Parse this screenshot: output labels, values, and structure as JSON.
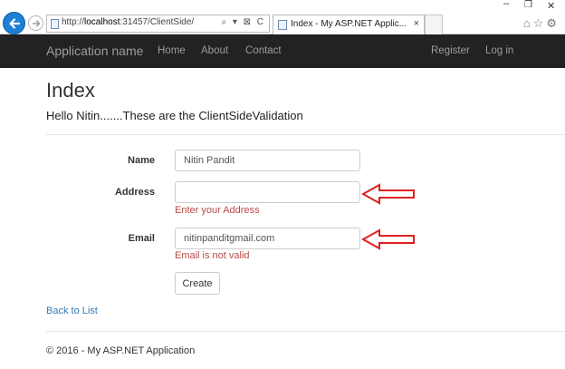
{
  "browser": {
    "url_prefix": "http://",
    "url_host": "localhost",
    "url_rest": ":31457/ClientSide/",
    "address_tools": "⌕ ▾ ⊠ C",
    "tab_title": "Index - My ASP.NET Applic...",
    "tab_close": "×",
    "window_controls": {
      "minimize": "–",
      "restore": "❐",
      "close": "✕"
    },
    "toolbar_icons": "⌂☆⚙"
  },
  "navbar": {
    "brand": "Application name",
    "links": [
      "Home",
      "About",
      "Contact"
    ],
    "right_links": [
      "Register",
      "Log in"
    ]
  },
  "page": {
    "title": "Index",
    "subtitle": "Hello Nitin.......These are the ClientSideValidation"
  },
  "form": {
    "name_label": "Name",
    "name_value": "Nitin Pandit",
    "address_label": "Address",
    "address_value": "",
    "address_error": "Enter your Address",
    "email_label": "Email",
    "email_value": "nitinpanditgmail.com",
    "email_error": "Email is not valid",
    "submit_label": "Create"
  },
  "back_link": "Back to List",
  "footer": "© 2016 - My ASP.NET Application",
  "colors": {
    "navbar_bg": "#222222",
    "nav_text": "#9d9d9d",
    "error_text": "#b94a48",
    "link": "#337ab7",
    "annotation_arrow": "#e02020",
    "back_button": "#1e7fd4"
  }
}
